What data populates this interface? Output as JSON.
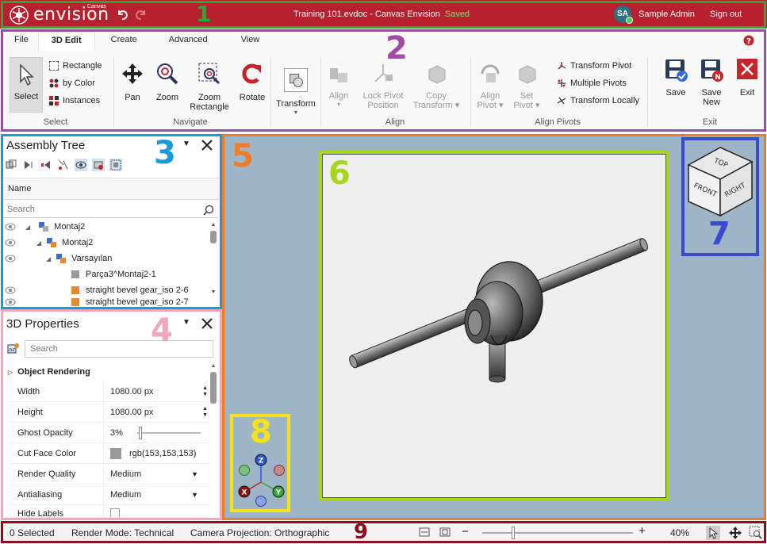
{
  "titlebar": {
    "brand": "envision",
    "brand_small": "Canvas",
    "doc_title": "Training 101.evdoc - Canvas Envision",
    "status": "Saved",
    "avatar_initials": "SA",
    "user_name": "Sample Admin",
    "sign_out": "Sign out"
  },
  "ribbon": {
    "tabs": [
      "File",
      "3D Edit",
      "Create",
      "Advanced",
      "View"
    ],
    "select": {
      "select_label": "Select",
      "rectangle": "Rectangle",
      "by_color": "by Color",
      "instances": "Instances",
      "group": "Select"
    },
    "navigate": {
      "pan": "Pan",
      "zoom": "Zoom",
      "zoom_rect_1": "Zoom",
      "zoom_rect_2": "Rectangle",
      "rotate": "Rotate",
      "group": "Navigate"
    },
    "transform": "Transform",
    "align": {
      "align": "Align",
      "lock_1": "Lock Pivot",
      "lock_2": "Position",
      "copy_1": "Copy",
      "copy_2": "Transform",
      "group": "Align"
    },
    "align_pivots": {
      "align_1": "Align",
      "align_2": "Pivot",
      "set_1": "Set",
      "set_2": "Pivot",
      "transform_pivot": "Transform Pivot",
      "multiple_pivots": "Multiple Pivots",
      "transform_locally": "Transform Locally",
      "group": "Align Pivots"
    },
    "exit": {
      "save": "Save",
      "save_new_1": "Save",
      "save_new_2": "New",
      "exit": "Exit",
      "group": "Exit"
    }
  },
  "assembly_tree": {
    "title": "Assembly Tree",
    "column": "Name",
    "search_placeholder": "Search",
    "rows": [
      "Montaj2",
      "Montaj2",
      "Varsayılan",
      "Parça3^Montaj2-1",
      "straight bevel gear_iso 2-6",
      "straight bevel gear_iso 2-7"
    ]
  },
  "properties": {
    "title": "3D Properties",
    "search_placeholder": "Search",
    "section": "Object Rendering",
    "rows": [
      {
        "label": "Width",
        "value": "1080.00 px"
      },
      {
        "label": "Height",
        "value": "1080.00 px"
      },
      {
        "label": "Ghost Opacity",
        "value": "3%"
      },
      {
        "label": "Cut Face Color",
        "value": "rgb(153,153,153)"
      },
      {
        "label": "Render Quality",
        "value": "Medium"
      },
      {
        "label": "Antialiasing",
        "value": "Medium"
      },
      {
        "label": "Hide Labels",
        "value": ""
      }
    ]
  },
  "viewcube": {
    "top": "TOP",
    "front": "FRONT",
    "right": "RIGHT"
  },
  "triad": {
    "z": "Z",
    "x": "X",
    "y": "Y"
  },
  "statusbar": {
    "selected": "0 Selected",
    "render_mode": "Render Mode: Technical",
    "projection": "Camera Projection: Orthographic",
    "zoom_level": "40%",
    "zoom_fraction": 0.2
  },
  "annotations": {
    "n1": "1",
    "n2": "2",
    "n3": "3",
    "n4": "4",
    "n5": "5",
    "n6": "6",
    "n7": "7",
    "n8": "8",
    "n9": "9",
    "colors": {
      "n1": "#1faa3a",
      "n2": "#a24aa8",
      "n3": "#1a9ad6",
      "n4": "#f2a6c0",
      "n5": "#f07c28",
      "n6": "#a6d61e",
      "n7": "#3a4ad0",
      "n8": "#f5e21a",
      "n9": "#8a1020"
    }
  },
  "theme": {
    "title_red": "#b7202e",
    "viewport_bg": "#9eb5c8",
    "accent_red": "#c4262e"
  }
}
